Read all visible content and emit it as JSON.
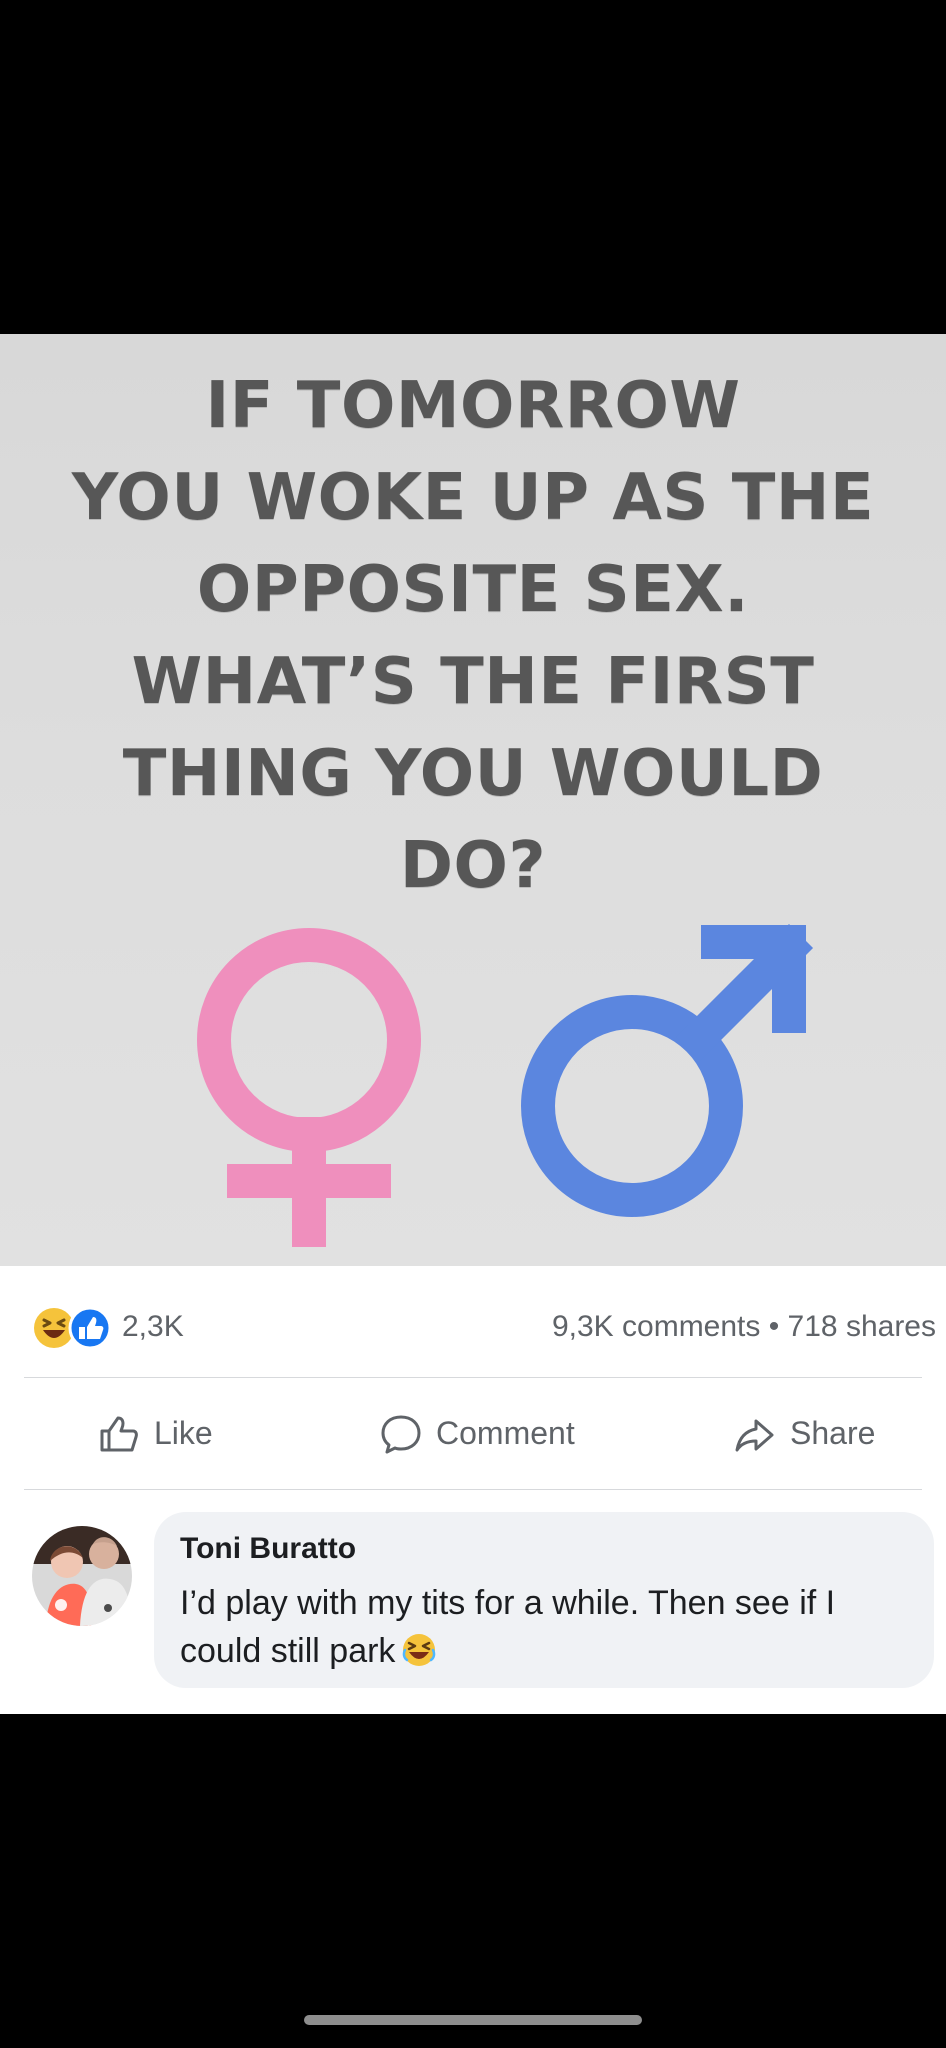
{
  "post": {
    "meme_lines": [
      "IF TOMORROW",
      "YOU WOKE UP AS THE",
      "OPPOSITE SEX.",
      "WHAT’S THE FIRST",
      "THING YOU WOULD",
      "DO?"
    ],
    "colors": {
      "female_symbol": "#ef8fbd",
      "male_symbol": "#5b86df",
      "meme_text": "#575757",
      "image_background": "#dddddd"
    }
  },
  "reactions": {
    "icons": [
      "laugh-icon",
      "like-icon"
    ],
    "count": "2,3K"
  },
  "stats": {
    "summary": "9,3K comments • 718 shares"
  },
  "actions": {
    "like": "Like",
    "comment": "Comment",
    "share": "Share"
  },
  "comment": {
    "author": "Toni Buratto",
    "text_before_emoji": "I’d play with my tits for a while. Then see if I could still park",
    "emoji": "laughing-emoji"
  }
}
